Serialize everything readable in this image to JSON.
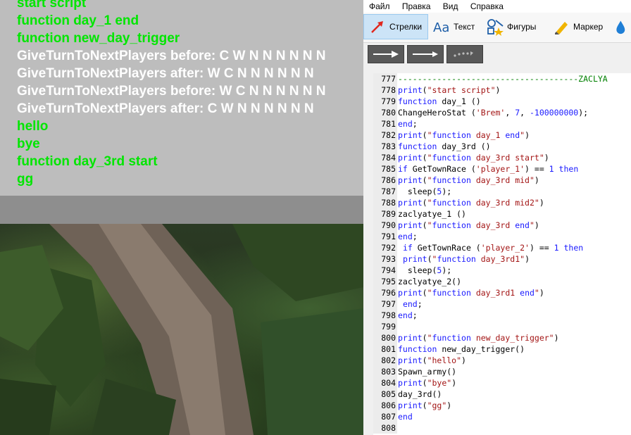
{
  "game_log": {
    "lines": [
      {
        "text": "start script",
        "color": "#00e600"
      },
      {
        "text": "function day_1 end",
        "color": "#00e600"
      },
      {
        "text": "function new_day_trigger",
        "color": "#00e600"
      },
      {
        "text": "GiveTurnToNextPlayers before: C W N N N N N N",
        "color": "#ffffff"
      },
      {
        "text": "GiveTurnToNextPlayers after: W C N N N N N N",
        "color": "#ffffff"
      },
      {
        "text": "GiveTurnToNextPlayers before: W C N N N N N N",
        "color": "#ffffff"
      },
      {
        "text": "GiveTurnToNextPlayers after: C W N N N N N N",
        "color": "#ffffff"
      },
      {
        "text": "hello",
        "color": "#00e600"
      },
      {
        "text": "bye",
        "color": "#00e600"
      },
      {
        "text": "function day_3rd start",
        "color": "#00e600"
      },
      {
        "text": "gg",
        "color": "#00e600"
      }
    ]
  },
  "editor": {
    "menu": [
      "Файл",
      "Правка",
      "Вид",
      "Справка"
    ],
    "tools": {
      "arrows": "Стрелки",
      "text": "Текст",
      "shapes": "Фигуры",
      "marker": "Маркер"
    },
    "icons": {
      "arrows": "arrow-tool-icon",
      "text": "text-tool-icon",
      "shapes": "shapes-tool-icon",
      "marker": "marker-tool-icon",
      "blur": "drop-tool-icon"
    },
    "colors": {
      "selected_tool_bg": "#cce4f7",
      "keyword": "#1a1aff",
      "string": "#a31515",
      "comment": "#008000"
    },
    "code": [
      {
        "n": "777",
        "t": "-------------------------------------ZACLYA"
      },
      {
        "n": "778",
        "t": "print(\"start script\")"
      },
      {
        "n": "779",
        "t": "function day_1 ()"
      },
      {
        "n": "780",
        "t": "ChangeHeroStat ('Brem', 7, -100000000);"
      },
      {
        "n": "781",
        "t": "end;"
      },
      {
        "n": "782",
        "t": "print(\"function day_1 end\")"
      },
      {
        "n": "783",
        "t": "function day_3rd ()"
      },
      {
        "n": "784",
        "t": "print(\"function day_3rd start\")"
      },
      {
        "n": "785",
        "t": "if GetTownRace ('player_1') == 1 then"
      },
      {
        "n": "786",
        "t": "print(\"function day_3rd mid\")"
      },
      {
        "n": "787",
        "t": "  sleep(5);"
      },
      {
        "n": "788",
        "t": "print(\"function day_3rd mid2\")"
      },
      {
        "n": "789",
        "t": "zaclyatye_1 ()"
      },
      {
        "n": "790",
        "t": "print(\"function day_3rd end\")"
      },
      {
        "n": "791",
        "t": "end;"
      },
      {
        "n": "792",
        "t": " if GetTownRace ('player_2') == 1 then"
      },
      {
        "n": "793",
        "t": " print(\"function day_3rd1\")"
      },
      {
        "n": "794",
        "t": "  sleep(5);"
      },
      {
        "n": "795",
        "t": "zaclyatye_2()"
      },
      {
        "n": "796",
        "t": "print(\"function day_3rd1 end\")"
      },
      {
        "n": "797",
        "t": " end;"
      },
      {
        "n": "798",
        "t": "end;"
      },
      {
        "n": "799",
        "t": ""
      },
      {
        "n": "800",
        "t": "print(\"function new_day_trigger\")"
      },
      {
        "n": "801",
        "t": "function new_day_trigger()"
      },
      {
        "n": "802",
        "t": "print(\"hello\")"
      },
      {
        "n": "803",
        "t": "Spawn_army()"
      },
      {
        "n": "804",
        "t": "print(\"bye\")"
      },
      {
        "n": "805",
        "t": "day_3rd()"
      },
      {
        "n": "806",
        "t": "print(\"gg\")"
      },
      {
        "n": "807",
        "t": "end"
      },
      {
        "n": "808",
        "t": ""
      }
    ]
  }
}
